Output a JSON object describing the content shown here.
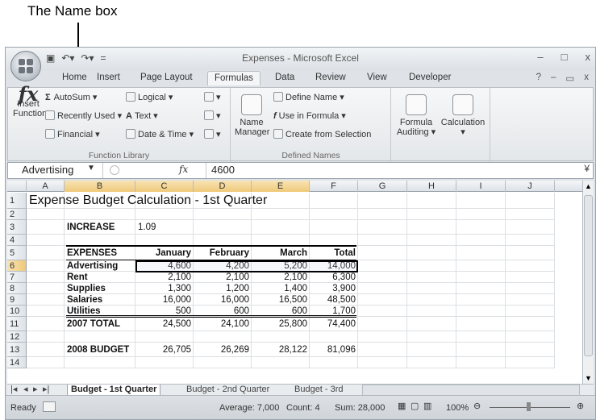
{
  "annotation": {
    "label": "The Name box"
  },
  "window": {
    "title": "Expenses - Microsoft Excel",
    "minimize": "–",
    "maximize": "□",
    "close": "x"
  },
  "ribbon_tabs": [
    "Home",
    "Insert",
    "Page Layout",
    "Formulas",
    "Data",
    "Review",
    "View",
    "Developer"
  ],
  "active_tab": "Formulas",
  "ribbon": {
    "insert_function": {
      "symbol": "fx",
      "line1": "Insert",
      "line2": "Function"
    },
    "function_library": {
      "autosum": "AutoSum ▾",
      "recently_used": "Recently Used ▾",
      "financial": "Financial ▾",
      "logical": "Logical ▾",
      "text": "Text ▾",
      "date_time": "Date & Time ▾",
      "label": "Function Library"
    },
    "defined_names": {
      "name_manager_1": "Name",
      "name_manager_2": "Manager",
      "define_name": "Define Name ▾",
      "use_in_formula": "Use in Formula ▾",
      "create_from_selection": "Create from Selection",
      "label": "Defined Names"
    },
    "formula_auditing": {
      "line1": "Formula",
      "line2": "Auditing ▾"
    },
    "calculation": {
      "line1": "Calculation",
      "line2": "▾"
    }
  },
  "formula_bar": {
    "name_box": "Advertising",
    "fx": "fx",
    "value": "4600"
  },
  "columns": [
    "A",
    "B",
    "C",
    "D",
    "E",
    "F",
    "G",
    "H",
    "I",
    "J"
  ],
  "rows": [
    "1",
    "2",
    "3",
    "4",
    "5",
    "6",
    "7",
    "8",
    "9",
    "10",
    "11",
    "12",
    "13",
    "14"
  ],
  "sheet": {
    "title": "Expense Budget Calculation - 1st Quarter",
    "increase_label": "INCREASE",
    "increase_value": "1.09",
    "headers": [
      "EXPENSES",
      "January",
      "February",
      "March",
      "Total"
    ],
    "data_rows": [
      [
        "Advertising",
        "4,600",
        "4,200",
        "5,200",
        "14,000"
      ],
      [
        "Rent",
        "2,100",
        "2,100",
        "2,100",
        "6,300"
      ],
      [
        "Supplies",
        "1,300",
        "1,200",
        "1,400",
        "3,900"
      ],
      [
        "Salaries",
        "16,000",
        "16,000",
        "16,500",
        "48,500"
      ],
      [
        "Utilities",
        "500",
        "600",
        "600",
        "1,700"
      ]
    ],
    "total_row": [
      "2007 TOTAL",
      "24,500",
      "24,100",
      "25,800",
      "74,400"
    ],
    "budget_row": [
      "2008 BUDGET",
      "26,705",
      "26,269",
      "28,122",
      "81,096"
    ]
  },
  "sheet_tabs": [
    "Budget - 1st Quarter",
    "Budget - 2nd Quarter",
    "Budget - 3rd"
  ],
  "status_bar": {
    "ready": "Ready",
    "average": "Average: 7,000",
    "count": "Count: 4",
    "sum": "Sum: 28,000",
    "zoom": "100%"
  }
}
